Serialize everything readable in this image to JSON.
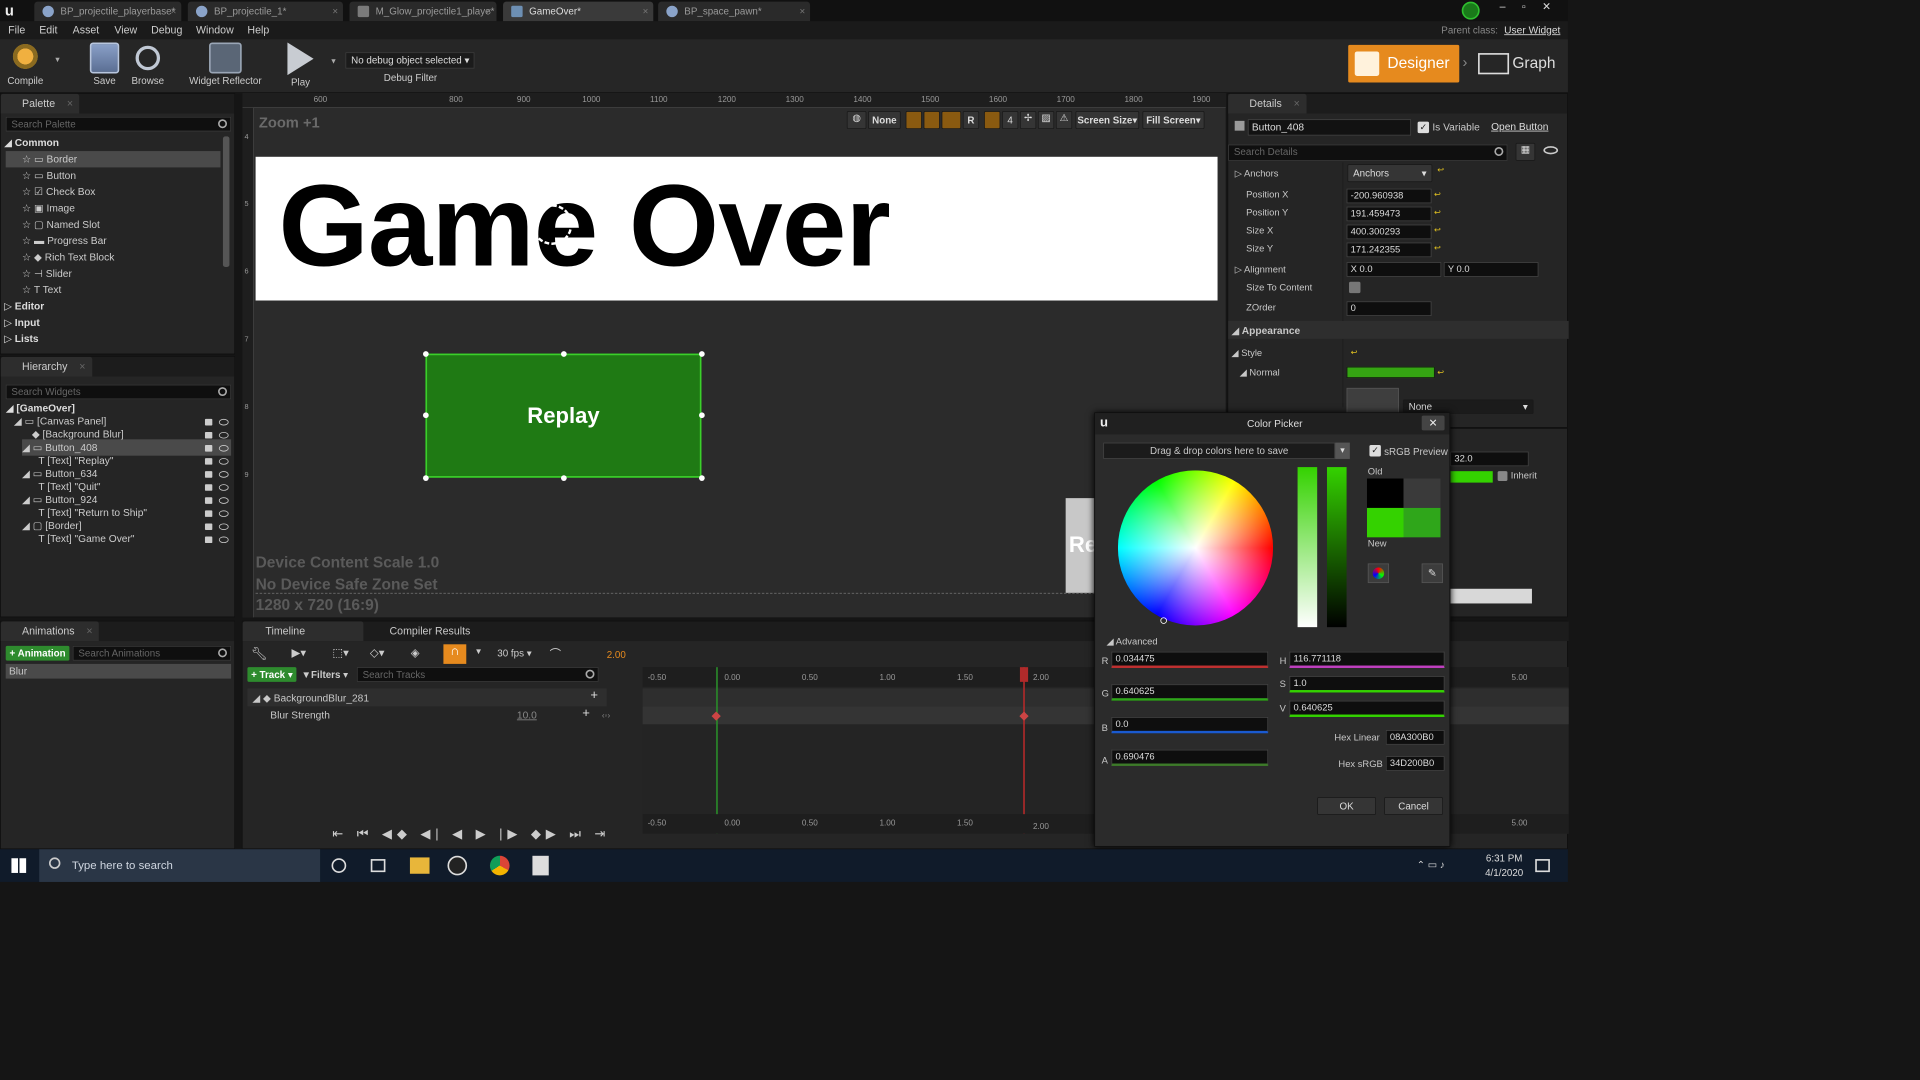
{
  "tabs": [
    {
      "label": "BP_projectile_playerbase*"
    },
    {
      "label": "BP_projectile_1*"
    },
    {
      "label": "M_Glow_projectile1_playe*"
    },
    {
      "label": "GameOver*"
    },
    {
      "label": "BP_space_pawn*"
    }
  ],
  "parent_class": {
    "prefix": "Parent class:",
    "value": "User Widget"
  },
  "menu": [
    "File",
    "Edit",
    "Asset",
    "View",
    "Debug",
    "Window",
    "Help"
  ],
  "toolbar": {
    "compile": "Compile",
    "save": "Save",
    "browse": "Browse",
    "widget_reflector": "Widget Reflector",
    "play": "Play",
    "debug_select": "No debug object selected",
    "debug_filter": "Debug Filter",
    "designer": "Designer",
    "graph": "Graph"
  },
  "palette": {
    "title": "Palette",
    "search": "Search Palette",
    "common": "Common",
    "items": [
      "Border",
      "Button",
      "Check Box",
      "Image",
      "Named Slot",
      "Progress Bar",
      "Rich Text Block",
      "Slider",
      "Text"
    ],
    "categories": [
      "Editor",
      "Input",
      "Lists"
    ]
  },
  "hierarchy": {
    "title": "Hierarchy",
    "search": "Search Widgets",
    "items": [
      "[GameOver]",
      "[Canvas Panel]",
      "[Background Blur]",
      "Button_408",
      "[Text] \"Replay\"",
      "Button_634",
      "[Text] \"Quit\"",
      "Button_924",
      "[Text] \"Return to Ship\"",
      "[Border]",
      "[Text] \"Game Over\""
    ]
  },
  "designer": {
    "zoom": "Zoom +1",
    "none": "None",
    "r": "R",
    "four": "4",
    "screen_size": "Screen Size",
    "fill_screen": "Fill Screen",
    "ruler_h": [
      "600",
      "800",
      "900",
      "1000",
      "1100",
      "1200",
      "1300",
      "1400",
      "1500",
      "1600",
      "1700",
      "1800",
      "1900"
    ],
    "ruler_v": [
      "4",
      "5",
      "6",
      "7",
      "8",
      "9"
    ],
    "game_over": "Game Over",
    "replay": "Replay",
    "partial_button": "Re",
    "device_scale": "Device Content Scale 1.0",
    "safe_zone": "No Device Safe Zone Set",
    "resolution": "1280 x 720 (16:9)"
  },
  "details": {
    "title": "Details",
    "name": "Button_408",
    "is_variable": "Is Variable",
    "open_button": "Open Button",
    "search": "Search Details",
    "anchors_label": "Anchors",
    "anchors_value": "Anchors",
    "position_x_label": "Position X",
    "position_x": "-200.960938",
    "position_y_label": "Position Y",
    "position_y": "191.459473",
    "size_x_label": "Size X",
    "size_x": "400.300293",
    "size_y_label": "Size Y",
    "size_y": "171.242355",
    "alignment_label": "Alignment",
    "align_x": "X 0.0",
    "align_y": "Y 0.0",
    "size_to_content": "Size To Content",
    "zorder_label": "ZOrder",
    "zorder": "0",
    "appearance": "Appearance",
    "style": "Style",
    "normal": "Normal",
    "none": "None",
    "partial_value": "32.0",
    "inherit": "Inherit",
    "normal_color": "#35a512"
  },
  "color_picker": {
    "title": "Color Picker",
    "drag_drop": "Drag & drop colors here to save",
    "srgb_preview": "sRGB Preview",
    "old": "Old",
    "new": "New",
    "advanced": "Advanced",
    "r_label": "R",
    "r": "0.034475",
    "g_label": "G",
    "g": "0.640625",
    "b_label": "B",
    "b": "0.0",
    "a_label": "A",
    "a": "0.690476",
    "h_label": "H",
    "h": "116.771118",
    "s_label": "S",
    "s": "1.0",
    "v_label": "V",
    "v": "0.640625",
    "hex_linear_label": "Hex Linear",
    "hex_linear": "08A300B0",
    "hex_srgb_label": "Hex sRGB",
    "hex_srgb": "34D200B0",
    "ok": "OK",
    "cancel": "Cancel",
    "new_color": "#34d200",
    "old_color": "#000000"
  },
  "animations": {
    "title": "Animations",
    "add": "Animation",
    "search": "Search Animations",
    "item": "Blur"
  },
  "timeline": {
    "tab": "Timeline",
    "compiler_tab": "Compiler Results",
    "fps": "30 fps",
    "end": "2.00",
    "track": "Track",
    "filters": "Filters",
    "search": "Search Tracks",
    "track_name": "BackgroundBlur_281",
    "property": "Blur Strength",
    "value": "10.0",
    "ticks": [
      "-0.50",
      "0.00",
      "0.50",
      "1.00",
      "1.50",
      "2.00",
      "5.00"
    ]
  },
  "taskbar": {
    "search": "Type here to search",
    "time": "6:31 PM",
    "date": "4/1/2020"
  }
}
